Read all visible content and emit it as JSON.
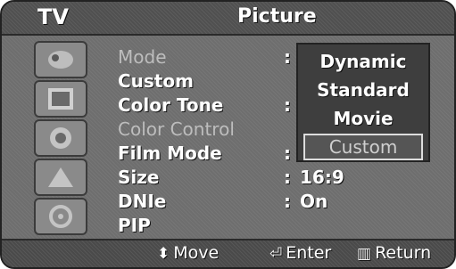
{
  "header": {
    "section": "TV",
    "title": "Picture"
  },
  "sidebar": {
    "icons": [
      "input-icon",
      "picture-icon",
      "sound-icon",
      "channel-icon",
      "setup-icon"
    ]
  },
  "menu": {
    "items": [
      {
        "label": "Mode",
        "value": ""
      },
      {
        "label": "Custom",
        "value": ""
      },
      {
        "label": "Color Tone",
        "value": ""
      },
      {
        "label": "Color Control",
        "value": ""
      },
      {
        "label": "Film Mode",
        "value": ""
      },
      {
        "label": "Size",
        "value": "16:9"
      },
      {
        "label": "DNIe",
        "value": "On"
      },
      {
        "label": "PIP",
        "value": ""
      }
    ]
  },
  "mode_options": {
    "options": [
      "Dynamic",
      "Standard",
      "Movie",
      "Custom"
    ],
    "selected": "Custom"
  },
  "footer": {
    "move": {
      "icon": "up-down-arrows-icon",
      "label": "Move"
    },
    "enter": {
      "icon": "enter-icon",
      "label": "Enter"
    },
    "return": {
      "icon": "return-icon",
      "label": "Return"
    }
  }
}
